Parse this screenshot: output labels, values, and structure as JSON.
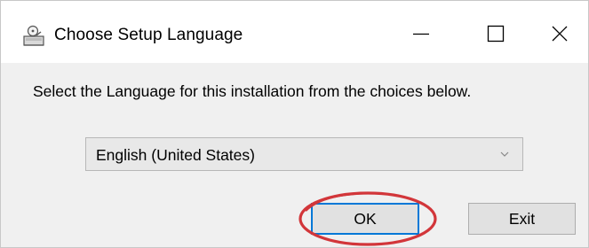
{
  "window": {
    "title": "Choose Setup Language",
    "controls": {
      "minimize_icon": "minimize-icon",
      "maximize_icon": "maximize-icon",
      "close_icon": "close-icon"
    }
  },
  "dialog": {
    "prompt": "Select the Language for this installation from the choices below.",
    "language_select": {
      "selected_value": "English (United States)"
    },
    "buttons": {
      "ok_label": "OK",
      "exit_label": "Exit"
    }
  },
  "annotation": {
    "highlight_color": "#d2363a",
    "highlight_target": "ok-button"
  },
  "colors": {
    "title_bar_bg": "#ffffff",
    "dialog_bg": "#f0f0f0",
    "button_bg": "#e1e1e1",
    "focus_border": "#0078d7"
  }
}
